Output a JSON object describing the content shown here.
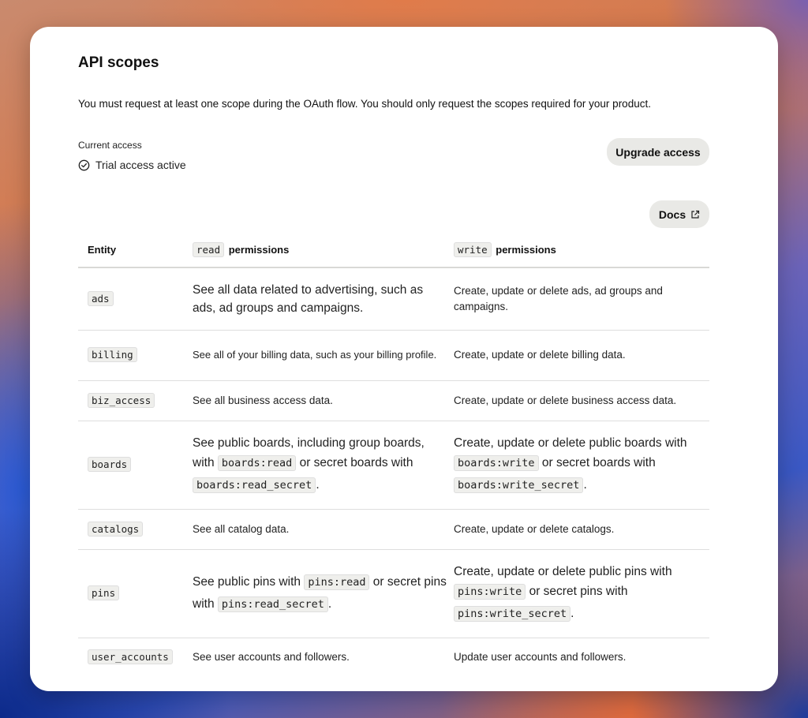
{
  "header": {
    "title": "API scopes",
    "subtitle": "You must request at least one scope during the OAuth flow. You should only request the scopes required for your product."
  },
  "access": {
    "current_label": "Current access",
    "status": "Trial access active",
    "upgrade_label": "Upgrade access",
    "docs_label": "Docs"
  },
  "table": {
    "headers": {
      "entity": "Entity",
      "read_code": "read",
      "read_text": "permissions",
      "write_code": "write",
      "write_text": "permissions"
    },
    "rows": [
      {
        "entity": "ads",
        "read": [
          "See all data related to advertising, such as ads, ad groups and campaigns."
        ],
        "write": [
          "Create, update or delete ads, ad groups and campaigns."
        ]
      },
      {
        "entity": "billing",
        "read": [
          "See all of your billing data, such as your billing profile."
        ],
        "write": [
          "Create, update or delete billing data."
        ]
      },
      {
        "entity": "biz_access",
        "read": [
          "See all business access data."
        ],
        "write": [
          "Create, update or delete business access data."
        ]
      },
      {
        "entity": "boards",
        "read": [
          "See public boards, including group boards, with ",
          "boards:read",
          " or secret boards with ",
          "boards:read_secret",
          "."
        ],
        "write": [
          "Create, update or delete public boards with ",
          "boards:write",
          " or secret boards with ",
          "boards:write_secret",
          "."
        ]
      },
      {
        "entity": "catalogs",
        "read": [
          "See all catalog data."
        ],
        "write": [
          "Create, update or delete catalogs."
        ]
      },
      {
        "entity": "pins",
        "read": [
          "See public pins with ",
          "pins:read",
          " or secret pins with ",
          "pins:read_secret",
          "."
        ],
        "write": [
          "Create, update or delete public pins with ",
          "pins:write",
          " or secret pins with ",
          "pins:write_secret",
          "."
        ]
      },
      {
        "entity": "user_accounts",
        "read": [
          "See user accounts and followers."
        ],
        "write": [
          "Update user accounts and followers."
        ]
      }
    ]
  }
}
